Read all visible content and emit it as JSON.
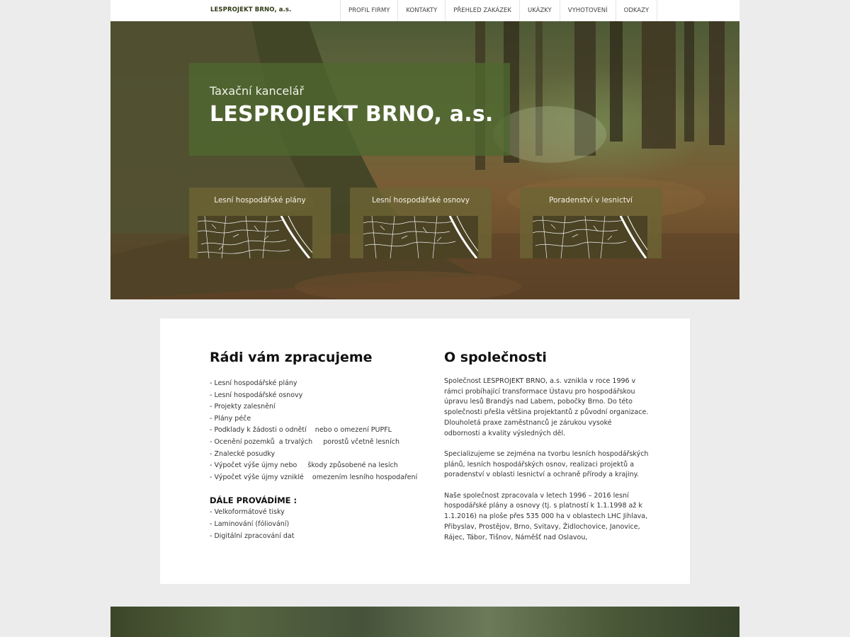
{
  "header": {
    "brand": "LESPROJEKT BRNO, a.s.",
    "nav": [
      {
        "label": "PROFIL FIRMY"
      },
      {
        "label": "KONTAKTY"
      },
      {
        "label": "PŘEHLED ZAKÁZEK"
      },
      {
        "label": "UKÁZKY"
      },
      {
        "label": "VYHOTOVENÍ"
      },
      {
        "label": "ODKAZY"
      }
    ]
  },
  "hero": {
    "subtitle": "Taxační kancelář",
    "title": "LESPROJEKT BRNO, a.s.",
    "cards": [
      {
        "title": "Lesní hospodářské plány"
      },
      {
        "title": "Lesní hospodářské osnovy"
      },
      {
        "title": "Poradenství v lesnictví"
      }
    ]
  },
  "services": {
    "heading": "Rádi vám zpracujeme",
    "items": [
      "- Lesní hospodářské plány",
      "- Lesní hospodářské osnovy",
      "- Projekty zalesnění",
      "- Plány péče",
      "- Podklady k žádosti o odnětí    nebo o omezení PUPFL",
      "- Ocenění pozemků  a trvalých     porostů včetně lesních",
      "- Znalecké posudky",
      "- Výpočet výše újmy nebo     škody způsobené na lesích",
      "- Výpočet výše újmy vzniklé    omezením lesního hospodaření"
    ],
    "more_heading": "DÁLE PROVÁDÍME :",
    "more_items": [
      "- Velkoformátové tisky",
      "- Laminování (fóliování)",
      "- Digitální zpracování dat"
    ]
  },
  "about": {
    "heading": "O společnosti",
    "paragraphs": [
      "Společnost LESPROJEKT BRNO, a.s. vznikla v roce 1996 v rámci probíhající transformace Ústavu pro hospodářskou úpravu lesů Brandýs nad Labem, pobočky Brno. Do této společnosti přešla většina projektantů z původní organizace. Dlouholetá praxe zaměstnanců je zárukou vysoké odbornosti a kvality výsledných děl.",
      "Specializujeme se zejména na tvorbu lesních hospodářských plánů, lesních hospodářských osnov, realizaci projektů a poradenství v oblasti lesnictví a ochraně přírody a krajiny.",
      "Naše společnost zpracovala v letech 1996 – 2016 lesní hospodářské plány a osnovy (tj. s platností k 1.1.1998 až k 1.1.2016) na ploše přes 535 000 ha v oblastech LHC Jihlava, Přibyslav, Prostějov, Brno, Svitavy, Židlochovice, Janovice, Rájec, Tábor, Tišnov, Náměšť nad Oslavou,"
    ]
  },
  "colors": {
    "title_box": "#4e6830",
    "card_bg": "#6c6434",
    "page_bg": "#ececec",
    "brand_text": "#2f3a14"
  }
}
